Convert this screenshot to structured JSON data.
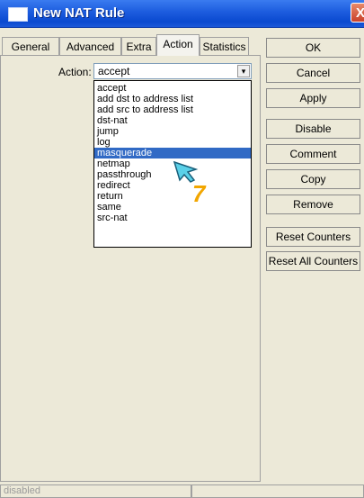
{
  "window": {
    "title": "New NAT Rule",
    "close_glyph": "X"
  },
  "tabs": [
    {
      "label": "General"
    },
    {
      "label": "Advanced"
    },
    {
      "label": "Extra"
    },
    {
      "label": "Action",
      "active": true
    },
    {
      "label": "Statistics"
    }
  ],
  "action": {
    "label": "Action:",
    "value": "accept",
    "arrow_glyph": "▾",
    "options": [
      "accept",
      "add dst to address list",
      "add src to address list",
      "dst-nat",
      "jump",
      "log",
      "masquerade",
      "netmap",
      "passthrough",
      "redirect",
      "return",
      "same",
      "src-nat"
    ],
    "highlighted": "masquerade"
  },
  "annotation": {
    "step_number": "7",
    "icon": "arrow-cursor-icon"
  },
  "buttons": {
    "ok": "OK",
    "cancel": "Cancel",
    "apply": "Apply",
    "disable": "Disable",
    "comment": "Comment",
    "copy": "Copy",
    "remove": "Remove",
    "reset_counters": "Reset Counters",
    "reset_all_counters": "Reset All Counters"
  },
  "status": {
    "state": "disabled"
  },
  "colors": {
    "titlebar": "#0a49d0",
    "selection": "#316ac5",
    "annotation": "#f2a600"
  }
}
